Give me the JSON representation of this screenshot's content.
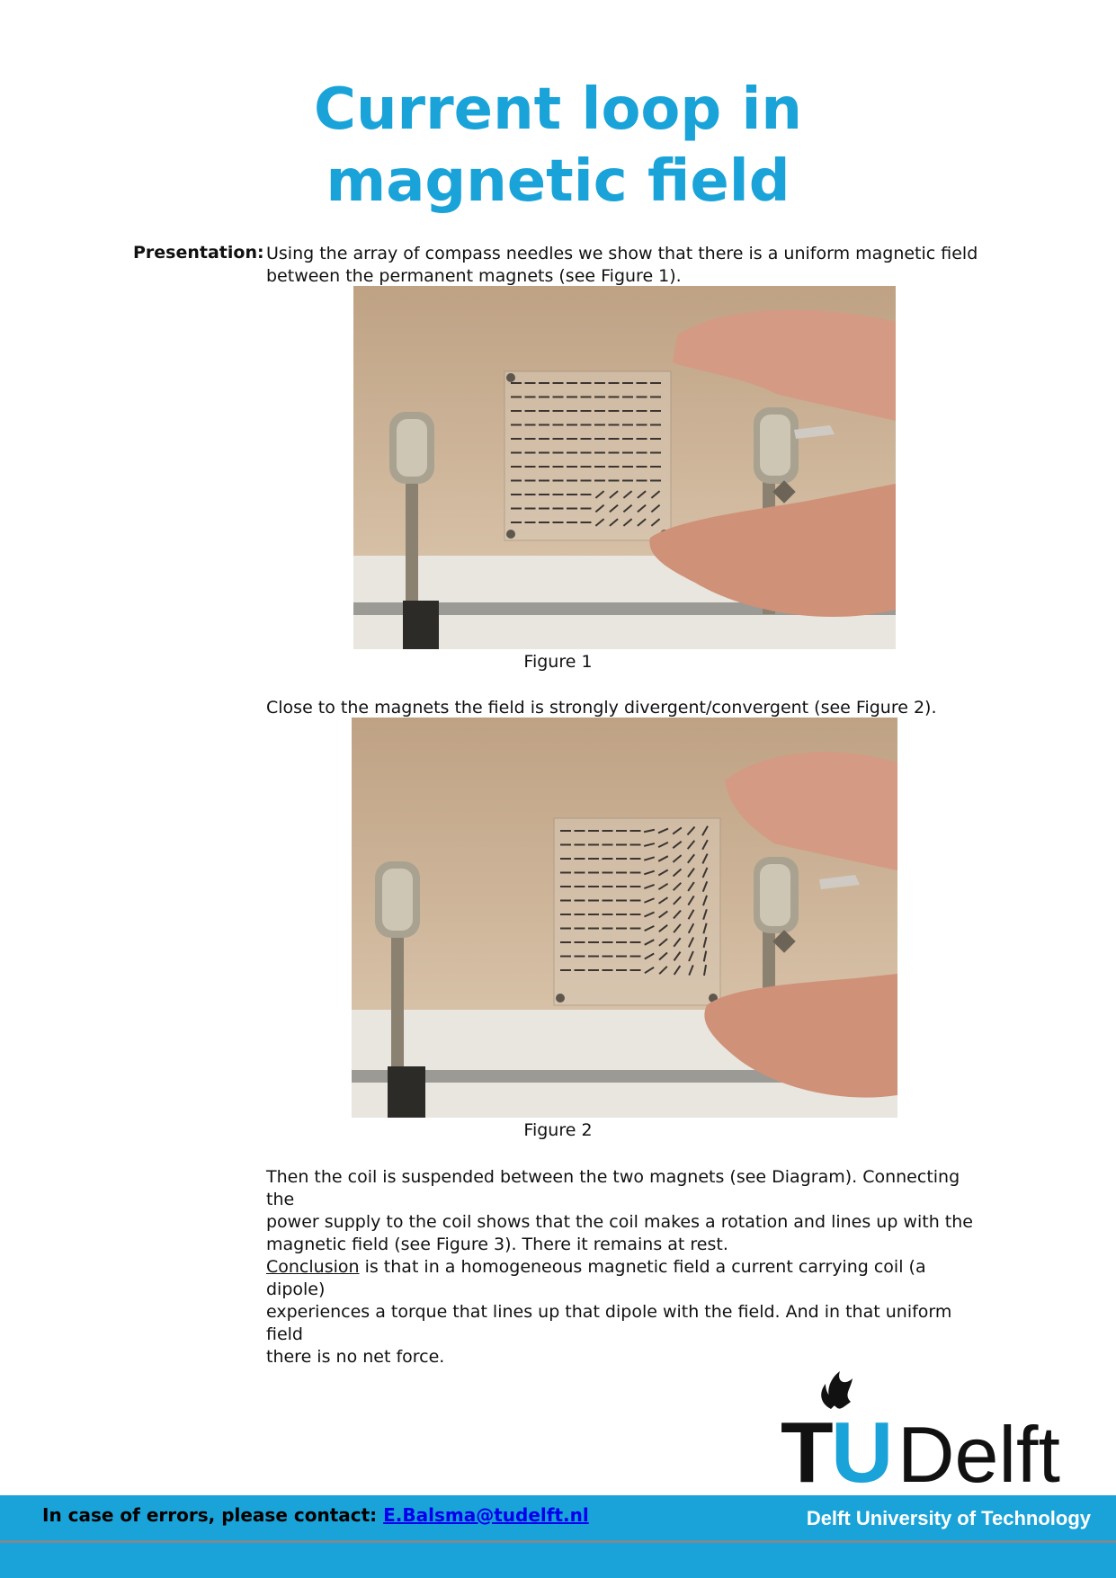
{
  "title_line1": "Current loop in",
  "title_line2": "magnetic field",
  "section_label": "Presentation:",
  "para1_line1": "Using the array of compass needles we show that there is a uniform magnetic field",
  "para1_line2": "between the permanent magnets (see Figure 1).",
  "figure1_caption": "Figure 1",
  "para2": "Close to the magnets the field is strongly divergent/convergent (see Figure 2).",
  "figure2_caption": "Figure 2",
  "para3_line1": "Then the coil is suspended between the two magnets (see Diagram). Connecting the",
  "para3_line2": "power supply to the coil shows that the coil makes a rotation and lines up with the",
  "para3_line3": "magnetic field (see Figure 3). There it remains at rest.",
  "conclusion_word": "Conclusion",
  "para4_line1_rest": " is that in a homogeneous magnetic field a current carrying coil (a dipole)",
  "para4_line2": "experiences a torque that lines up that dipole with the field. And in that uniform field",
  "para4_line3": "there is no net force.",
  "logo_text_t": "T",
  "logo_text_u": "U",
  "logo_text_delft": "Delft",
  "footer_contact_label": "In case of errors, please contact: ",
  "footer_contact_email": "E.Balsma@tudelft.nl",
  "footer_university": "Delft University of Technology",
  "colors": {
    "brand": "#1aa3d8",
    "wall": "#c9ac8f",
    "table": "#e6e2dc"
  }
}
